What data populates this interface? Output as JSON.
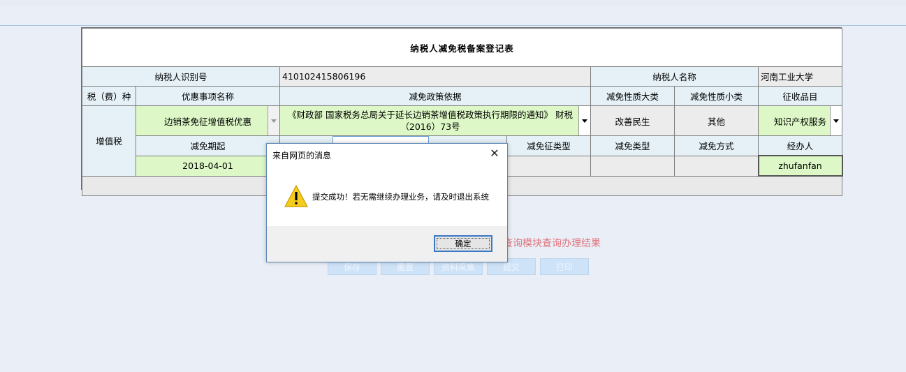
{
  "form": {
    "title": "纳税人减免税备案登记表",
    "taxpayer_id_label": "纳税人识别号",
    "taxpayer_id": "410102415806196",
    "taxpayer_name_label": "纳税人名称",
    "taxpayer_name": "河南工业大学",
    "tax_type_label": "税（费）种",
    "preference_name_label": "优惠事项名称",
    "policy_basis_label": "减免政策依据",
    "nature_major_label": "减免性质大类",
    "nature_minor_label": "减免性质小类",
    "collection_item_label": "征收品目",
    "tax_type": "增值税",
    "preference_name": "边销茶免征增值税优惠",
    "policy_basis": "《财政部 国家税务总局关于延长边销茶增值税政策执行期限的通知》 财税（2016）73号",
    "nature_major": "改善民生",
    "nature_minor": "其他",
    "collection_item": "知识产权服务",
    "start_label": "减免期起",
    "partial_label": "减免征类型",
    "exempt_type_label": "减免类型",
    "exempt_method_label": "减免方式",
    "handler_label": "经办人",
    "start_date": "2018-04-01",
    "handler": "zhufanfan"
  },
  "notice": "查询模块查询办理结果",
  "buttons": [
    "保存",
    "重置",
    "资料采集",
    "提交",
    "打印"
  ],
  "dialog": {
    "title": "来自网页的消息",
    "message": "提交成功！若无需继续办理业务，请及时退出系统",
    "ok": "确定"
  }
}
